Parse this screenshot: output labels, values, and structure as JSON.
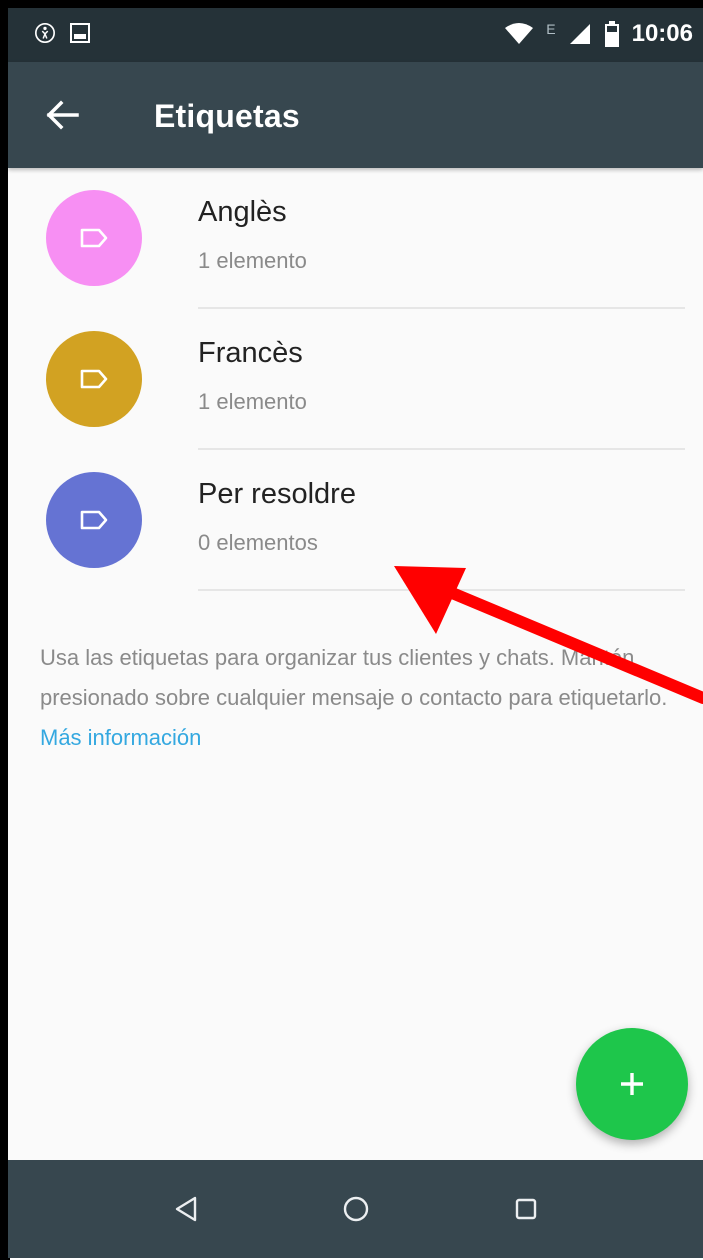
{
  "status_bar": {
    "time": "10:06",
    "network_letter": "E",
    "icons": [
      "accessibility-icon",
      "image-icon",
      "wifi-icon",
      "signal-icon",
      "battery-icon"
    ]
  },
  "app_bar": {
    "back_icon": "arrow-left-icon",
    "title": "Etiquetas"
  },
  "labels": [
    {
      "name": "Anglès",
      "count": "1 elemento",
      "color": "#f78ff3",
      "icon": "tag-icon"
    },
    {
      "name": "Francès",
      "count": "1 elemento",
      "color": "#d2a222",
      "icon": "tag-icon"
    },
    {
      "name": "Per resoldre",
      "count": "0 elementos",
      "color": "#6573d3",
      "icon": "tag-icon"
    }
  ],
  "info": {
    "text": "Usa las etiquetas para organizar tus clientes y chats. Mantén presionado sobre cualquier mensaje o contacto para etiquetarlo.",
    "link": "Más información"
  },
  "fab": {
    "icon": "plus-icon",
    "color": "#1ec64b"
  },
  "nav_bar": {
    "buttons": [
      "back-triangle-icon",
      "home-circle-icon",
      "recents-square-icon"
    ]
  },
  "annotation": {
    "color": "#ff0000",
    "type": "arrow"
  }
}
